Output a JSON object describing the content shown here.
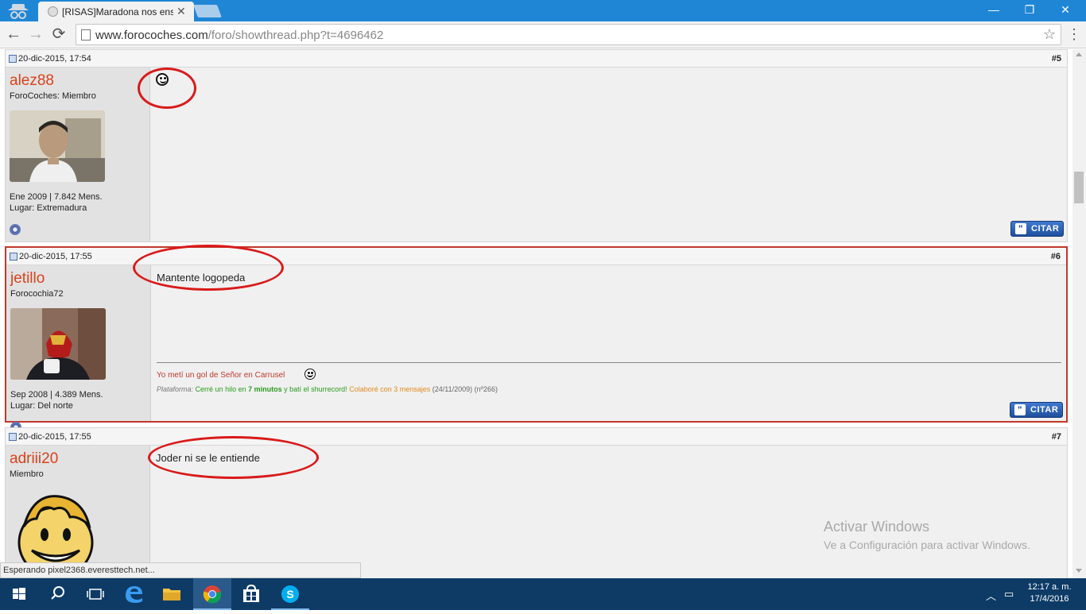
{
  "browser": {
    "tab_title": "[RISAS]Maradona nos ens",
    "tab_close": "✕",
    "url_host": "www.forocoches.com",
    "url_path": "/foro/showthread.php?t=4696462",
    "window_min": "—",
    "window_restore": "❐",
    "window_close": "✕",
    "back": "←",
    "forward": "→",
    "reload": "⟳",
    "star": "☆",
    "menu": "⋮"
  },
  "posts": [
    {
      "date": "20-dic-2015, 17:54",
      "number": "#5",
      "username": "alez88",
      "user_title": "ForoCoches: Miembro",
      "join_info": "Ene 2009 | 7.842 Mens.",
      "location": "Lugar: Extremadura",
      "message": "",
      "quote_label": "CITAR"
    },
    {
      "date": "20-dic-2015, 17:55",
      "number": "#6",
      "username": "jetillo",
      "user_title": "Forocochia72",
      "join_info": "Sep 2008 | 4.389 Mens.",
      "location": "Lugar: Del norte",
      "message": "Mantente logopeda",
      "signature_line1": "Yo metí un gol de Señor en Carrusel",
      "sig_plataforma": "Plataforma:",
      "sig_cerre": "Cerré un hilo en",
      "sig_minutos": "7 minutos",
      "sig_bati": "y batí el shurrecord!",
      "sig_colabore": "Colaboré con 3 mensajes",
      "sig_date": "(24/11/2009) (nº266)",
      "quote_label": "CITAR"
    },
    {
      "date": "20-dic-2015, 17:55",
      "number": "#7",
      "username": "adriii20",
      "user_title": "Miembro",
      "message": "Joder ni se le entiende"
    }
  ],
  "status_text": "Esperando pixel2368.everesttech.net...",
  "watermark": {
    "title": "Activar Windows",
    "subtitle": "Ve a Configuración para activar Windows."
  },
  "taskbar": {
    "time": "12:17 a. m.",
    "date": "17/4/2016"
  },
  "colors": {
    "titlebar": "#1f86d6",
    "username": "#d9421a",
    "highlight_border": "#c0392b",
    "annotation_ring": "#d91a1a",
    "taskbar": "#0d3b66"
  }
}
